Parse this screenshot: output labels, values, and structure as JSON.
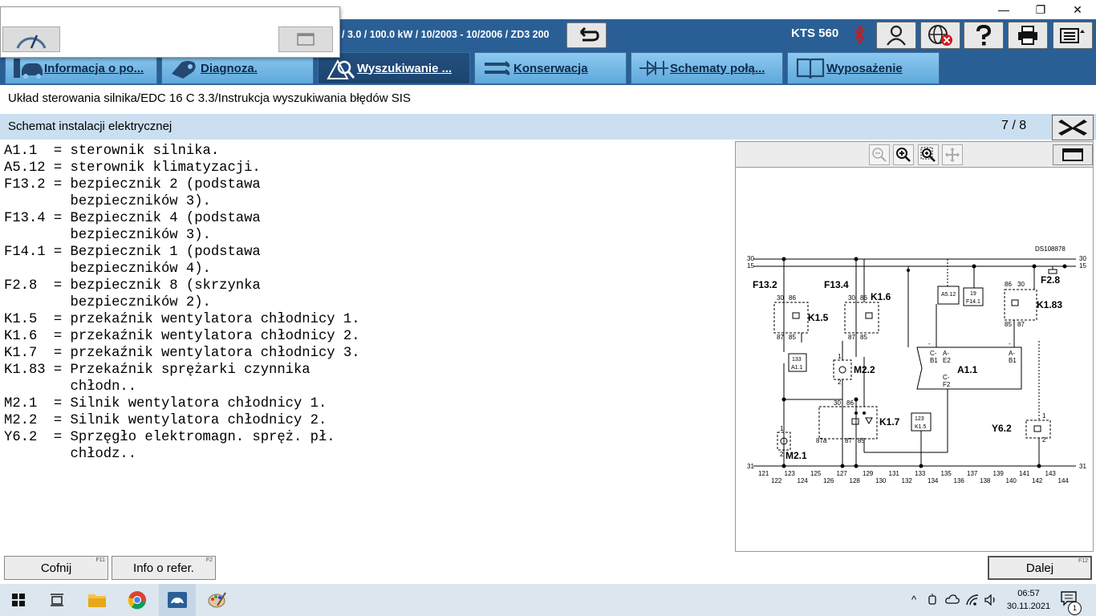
{
  "window": {
    "minimize": "—",
    "restore": "❐",
    "close": "✕"
  },
  "header": {
    "vehicle_info": "/ 3.0 / 100.0 kW / 10/2003 - 10/2006 / ZD3 200",
    "device": "KTS 560"
  },
  "tabs": [
    {
      "label": "Informacja o po...",
      "icon": "car-info-icon",
      "active": false
    },
    {
      "label": "Diagnoza.",
      "icon": "diagnosis-plug-icon",
      "active": false
    },
    {
      "label": "Wyszukiwanie ...",
      "icon": "search-fault-icon",
      "active": true
    },
    {
      "label": "Konserwacja",
      "icon": "maintenance-wrench-icon",
      "active": false
    },
    {
      "label": "Schematy połą...",
      "icon": "circuit-diagram-icon",
      "active": false
    },
    {
      "label": "Wyposażenie",
      "icon": "book-icon",
      "active": false
    }
  ],
  "breadcrumb": "Układ sterowania silnika/EDC 16 C 3.3/Instrukcja wyszukiwania błędów SIS",
  "section": {
    "title": "Schemat instalacji elektrycznej",
    "page": "7 / 8"
  },
  "legend_text": "A1.1  = sterownik silnika.\nA5.12 = sterownik klimatyzacji.\nF13.2 = bezpiecznik 2 (podstawa\n        bezpieczników 3).\nF13.4 = Bezpiecznik 4 (podstawa\n        bezpieczników 3).\nF14.1 = Bezpiecznik 1 (podstawa\n        bezpieczników 4).\nF2.8  = bezpiecznik 8 (skrzynka\n        bezpieczników 2).\nK1.5  = przekaźnik wentylatora chłodnicy 1.\nK1.6  = przekaźnik wentylatora chłodnicy 2.\nK1.7  = przekaźnik wentylatora chłodnicy 3.\nK1.83 = Przekaźnik sprężarki czynnika\n        chłodn..\nM2.1  = Silnik wentylatora chłodnicy 1.\nM2.2  = Silnik wentylatora chłodnicy 2.\nY6.2  = Sprzęgło elektromagn. spręż. pł.\n        chłodz..",
  "diagram": {
    "id": "DS108878",
    "rail_labels": [
      "30",
      "15",
      "31"
    ],
    "components": {
      "F13_2": "F13.2",
      "F13_4": "F13.4",
      "F2_8": "F2.8",
      "K1_5": "K1.5",
      "K1_6": "K1.6",
      "K1_7": "K1.7",
      "K1_83": "K1.83",
      "M2_1": "M2.1",
      "M2_2": "M2.2",
      "Y6_2": "Y6.2",
      "A1_1": "A1.1",
      "A5_12": "A5.12",
      "F14_1": "F14.1",
      "F14_1_num": "19",
      "ref133": "133",
      "ref133_target": "A1.1",
      "ref123": "123",
      "ref123_target": "K1.5"
    },
    "pins": {
      "p30": "30",
      "p86": "86",
      "p87": "87",
      "p85": "85",
      "p87a": "87a",
      "p1": "1",
      "p2": "2",
      "cb1": "C-",
      "cb1b": "B1",
      "ae2": "A-",
      "ae2b": "E2",
      "ab1": "A-",
      "ab1b": "B1",
      "cf2": "C-",
      "cf2b": "F2",
      "minus": "-"
    },
    "bottom_numbers_top": [
      "121",
      "123",
      "125",
      "127",
      "129",
      "131",
      "133",
      "135",
      "137",
      "139",
      "141",
      "143"
    ],
    "bottom_numbers_bottom": [
      "122",
      "124",
      "126",
      "128",
      "130",
      "132",
      "134",
      "136",
      "138",
      "140",
      "142",
      "144"
    ]
  },
  "buttons": {
    "back": {
      "label": "Cofnij",
      "fkey": "F11"
    },
    "info": {
      "label": "Info o refer.",
      "fkey": "F2"
    },
    "next": {
      "label": "Dalej",
      "fkey": "F12"
    }
  },
  "taskbar": {
    "time": "06:57",
    "date": "30.11.2021",
    "notification_count": "1",
    "tray_chevron": "^"
  },
  "colors": {
    "header_blue": "#2a5f96",
    "tab_light": "#6fb4e3",
    "section_bg": "#cbdff0",
    "bluetooth_red": "#d0171c"
  }
}
